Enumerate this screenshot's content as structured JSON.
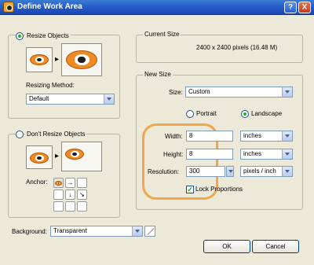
{
  "window": {
    "title": "Define Work Area",
    "help_label": "?",
    "close_label": "X"
  },
  "resize_objects": {
    "label": "Resize Objects",
    "selected": true
  },
  "resizing_method": {
    "label": "Resizing Method:",
    "value": "Default"
  },
  "dont_resize": {
    "label": "Don't Resize Objects",
    "selected": false
  },
  "anchor": {
    "label": "Anchor:",
    "arrow_right": "→",
    "arrow_down": "↓",
    "arrow_diag": "↘"
  },
  "current_size": {
    "label": "Current Size",
    "value": "2400 x 2400 pixels (16.48 M)"
  },
  "new_size": {
    "label": "New Size",
    "size_label": "Size:",
    "size_value": "Custom",
    "portrait_label": "Portrait",
    "landscape_label": "Landscape",
    "width_label": "Width:",
    "width_value": "8",
    "width_unit": "inches",
    "height_label": "Height:",
    "height_value": "8",
    "height_unit": "inches",
    "resolution_label": "Resolution:",
    "resolution_value": "300",
    "resolution_unit": "pixels / inch",
    "lock_label": "Lock Proportions",
    "lock_checked": true
  },
  "background": {
    "label": "Background:",
    "value": "Transparent"
  },
  "buttons": {
    "ok": "OK",
    "cancel": "Cancel"
  },
  "colors": {
    "highlight": "#f0a64a",
    "titlebar": "#2358c8",
    "dialog_bg": "#ece9d8"
  }
}
